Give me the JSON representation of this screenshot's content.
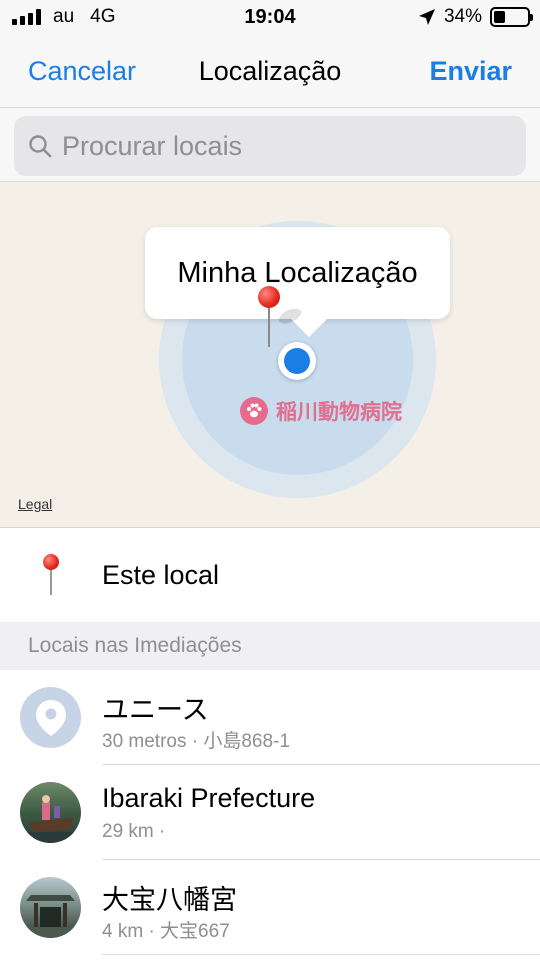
{
  "status_bar": {
    "carrier": "au",
    "network": "4G",
    "time": "19:04",
    "battery": "34%",
    "battery_level": 0.34
  },
  "nav": {
    "cancel_label": "Cancelar",
    "title": "Localização",
    "send_label": "Enviar"
  },
  "search": {
    "placeholder": "Procurar locais",
    "value": ""
  },
  "map": {
    "callout_label": "Minha Localização",
    "poi_label": "稲川動物病院",
    "legal_label": "Legal"
  },
  "this_place": {
    "label": "Este local"
  },
  "section": {
    "title": "Locais nas Imediações"
  },
  "places": [
    {
      "name": "ユニース",
      "detail": "30 metros · 小島868-1",
      "avatar": "location-pin-icon"
    },
    {
      "name": "Ibaraki Prefecture",
      "detail": "29 km ·",
      "avatar": "boat-photo"
    },
    {
      "name": "大宝八幡宮",
      "detail": "4 km · 大宝667",
      "avatar": "shrine-photo"
    }
  ],
  "colors": {
    "accent": "#1a7ee6",
    "pin": "#e3251b",
    "accuracy": "#c9dcee",
    "poi": "#e0708f"
  }
}
